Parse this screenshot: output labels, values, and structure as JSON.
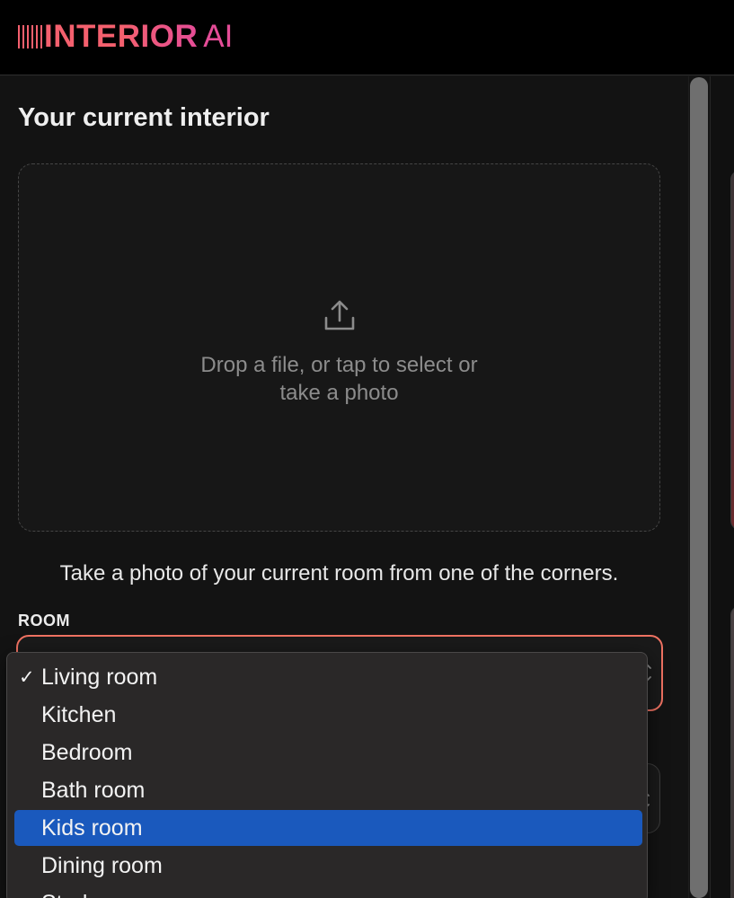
{
  "app": {
    "logo_text": "INTERIOR",
    "logo_suffix": "AI",
    "logo_bar_colors": [
      "#f4606e",
      "#f4606e",
      "#f4606e",
      "#f4606e",
      "#f4606e",
      "#f4606e"
    ]
  },
  "upload": {
    "title": "Your current interior",
    "icon": "upload-icon",
    "drop_line1": "Drop a file, or tap to select or",
    "drop_line2": "take a photo",
    "hint": "Take a photo of your current room from one of the corners."
  },
  "room": {
    "label": "ROOM",
    "selected": "Living room",
    "options": [
      "Living room",
      "Kitchen",
      "Bedroom",
      "Bath room",
      "Kids room",
      "Dining room",
      "Study room"
    ],
    "highlighted": "Kids room",
    "checkmark": "✓"
  },
  "colors": {
    "accent": "#ef7262",
    "brand_gradient": [
      "#f4606e",
      "#e44c97"
    ],
    "highlight": "#1a59bd"
  }
}
